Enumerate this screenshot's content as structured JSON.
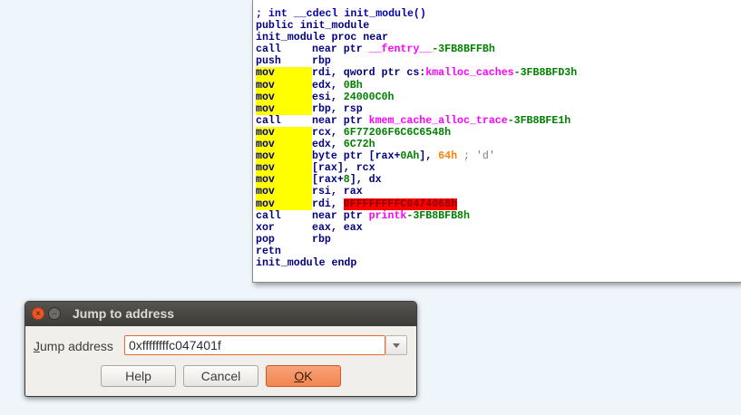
{
  "disassembly": {
    "lines": [
      {
        "segs": [
          {
            "t": "; int __cdecl init_module()",
            "c": "c-comment"
          }
        ]
      },
      {
        "segs": [
          {
            "t": "public init_module"
          }
        ]
      },
      {
        "segs": [
          {
            "t": "init_module proc near"
          }
        ]
      },
      {
        "mn": "call",
        "segs": [
          {
            "t": "near ptr "
          },
          {
            "t": "__fentry__",
            "c": "c-sym"
          },
          {
            "t": "-3FB8BFFBh",
            "c": "c-offset"
          }
        ]
      },
      {
        "mn": "push",
        "segs": [
          {
            "t": "rbp"
          }
        ]
      },
      {
        "mn": "mov",
        "hl": true,
        "segs": [
          {
            "t": "rdi, qword ptr cs:"
          },
          {
            "t": "kmalloc_caches",
            "c": "c-sym"
          },
          {
            "t": "-3FB8BFD3h",
            "c": "c-offset"
          }
        ]
      },
      {
        "mn": "mov",
        "hl": true,
        "segs": [
          {
            "t": "edx, "
          },
          {
            "t": "0Bh",
            "c": "c-num"
          }
        ]
      },
      {
        "mn": "mov",
        "hl": true,
        "segs": [
          {
            "t": "esi, "
          },
          {
            "t": "24000C0h",
            "c": "c-num"
          }
        ]
      },
      {
        "mn": "mov",
        "hl": true,
        "segs": [
          {
            "t": "rbp, rsp"
          }
        ]
      },
      {
        "mn": "call",
        "segs": [
          {
            "t": "near ptr "
          },
          {
            "t": "kmem_cache_alloc_trace",
            "c": "c-sym"
          },
          {
            "t": "-3FB8BFE1h",
            "c": "c-offset"
          }
        ]
      },
      {
        "mn": "mov",
        "hl": true,
        "segs": [
          {
            "t": "rcx, "
          },
          {
            "t": "6F77206F6C6C6548h",
            "c": "c-num"
          }
        ]
      },
      {
        "mn": "mov",
        "hl": true,
        "segs": [
          {
            "t": "edx, "
          },
          {
            "t": "6C72h",
            "c": "c-num"
          }
        ]
      },
      {
        "mn": "mov",
        "hl": true,
        "segs": [
          {
            "t": "byte ptr [rax+"
          },
          {
            "t": "0Ah",
            "c": "c-num"
          },
          {
            "t": "], "
          },
          {
            "t": "64h",
            "c": "c-char"
          },
          {
            "t": " ; 'd'",
            "c": "c-strcmt"
          }
        ]
      },
      {
        "mn": "mov",
        "hl": true,
        "segs": [
          {
            "t": "[rax], rcx"
          }
        ]
      },
      {
        "mn": "mov",
        "hl": true,
        "segs": [
          {
            "t": "[rax+"
          },
          {
            "t": "8",
            "c": "c-num"
          },
          {
            "t": "], dx"
          }
        ]
      },
      {
        "mn": "mov",
        "hl": true,
        "segs": [
          {
            "t": "rsi, rax"
          }
        ]
      },
      {
        "mn": "mov",
        "hl": true,
        "segs": [
          {
            "t": "rdi, "
          },
          {
            "t": "0FFFFFFFFC0474068h",
            "c": "c-err"
          }
        ]
      },
      {
        "mn": "call",
        "segs": [
          {
            "t": "near ptr "
          },
          {
            "t": "printk",
            "c": "c-sym"
          },
          {
            "t": "-3FB8BFB8h",
            "c": "c-offset"
          }
        ]
      },
      {
        "mn": "xor",
        "segs": [
          {
            "t": "eax, eax"
          }
        ]
      },
      {
        "mn": "pop",
        "segs": [
          {
            "t": "rbp"
          }
        ]
      },
      {
        "mn": "retn",
        "segs": []
      },
      {
        "segs": [
          {
            "t": "init_module endp"
          }
        ]
      }
    ]
  },
  "dialog": {
    "title": "Jump to address",
    "close_glyph": "×",
    "minimize_glyph": "–",
    "label_accel": "J",
    "label_rest": "ump address",
    "input_value": "0xffffffffc047401f",
    "help_label": "Help",
    "cancel_label": "Cancel",
    "ok_accel": "O",
    "ok_rest": "K"
  },
  "colors": {
    "mnemonic_highlight": "#ffff00",
    "error_address": "#ff0000",
    "symbol": "#ff00ff",
    "number": "#008000",
    "accent": "#e9682d"
  }
}
